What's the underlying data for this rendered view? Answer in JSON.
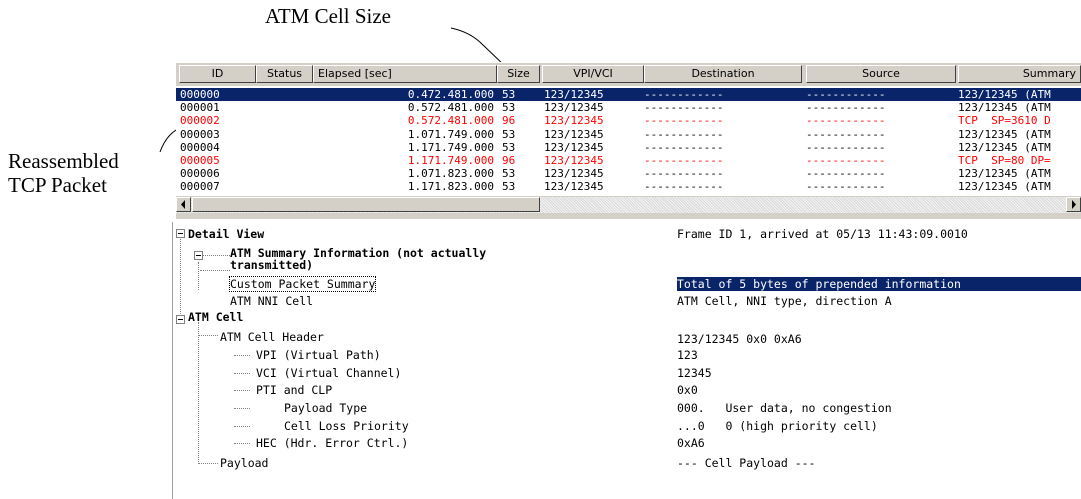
{
  "annotations": {
    "cell_size": "ATM Cell Size",
    "tcp_line1": "Reassembled",
    "tcp_line2": "TCP Packet"
  },
  "columns": [
    "ID",
    "Status",
    "Elapsed [sec]",
    "Size",
    "VPI/VCI",
    "Destination",
    "Source",
    "Summary"
  ],
  "frames": [
    {
      "id": "000000",
      "status": "",
      "elapsed": "0.472.481.000",
      "size": "53",
      "vpivci": "123/12345",
      "dest": "------------",
      "src": "------------",
      "summary": "123/12345 (ATM",
      "style": "selected"
    },
    {
      "id": "000001",
      "status": "",
      "elapsed": "0.572.481.000",
      "size": "53",
      "vpivci": "123/12345",
      "dest": "------------",
      "src": "------------",
      "summary": "123/12345 (ATM",
      "style": "normal"
    },
    {
      "id": "000002",
      "status": "",
      "elapsed": "0.572.481.000",
      "size": "96",
      "vpivci": "123/12345",
      "dest": "------------",
      "src": "------------",
      "summary": "TCP  SP=3610 D",
      "style": "red"
    },
    {
      "id": "000003",
      "status": "",
      "elapsed": "1.071.749.000",
      "size": "53",
      "vpivci": "123/12345",
      "dest": "------------",
      "src": "------------",
      "summary": "123/12345 (ATM",
      "style": "normal"
    },
    {
      "id": "000004",
      "status": "",
      "elapsed": "1.171.749.000",
      "size": "53",
      "vpivci": "123/12345",
      "dest": "------------",
      "src": "------------",
      "summary": "123/12345 (ATM",
      "style": "normal"
    },
    {
      "id": "000005",
      "status": "",
      "elapsed": "1.171.749.000",
      "size": "96",
      "vpivci": "123/12345",
      "dest": "------------",
      "src": "------------",
      "summary": "TCP  SP=80 DP=",
      "style": "red"
    },
    {
      "id": "000006",
      "status": "",
      "elapsed": "1.071.823.000",
      "size": "53",
      "vpivci": "123/12345",
      "dest": "------------",
      "src": "------------",
      "summary": "123/12345 (ATM",
      "style": "normal"
    },
    {
      "id": "000007",
      "status": "",
      "elapsed": "1.171.823.000",
      "size": "53",
      "vpivci": "123/12345",
      "dest": "------------",
      "src": "------------",
      "summary": "123/12345 (ATM",
      "style": "normal"
    }
  ],
  "detail": {
    "root_label": "Detail View",
    "root_value": "Frame ID 1, arrived at 05/13 11:43:09.0010",
    "atm_summary_label_1": "ATM Summary Information (not actually",
    "atm_summary_label_2": "transmitted)",
    "custom_summary_label": "Custom Packet Summary",
    "custom_summary_value": "Total of 5 bytes of prepended information",
    "nni_cell_label": "ATM NNI Cell",
    "nni_cell_value": "ATM Cell, NNI type, direction A",
    "atm_cell_label": "ATM Cell",
    "header_label": "ATM Cell Header",
    "header_value": "123/12345 0x0 0xA6",
    "vpi_label": "VPI (Virtual Path)",
    "vpi_value": "123",
    "vci_label": "VCI (Virtual Channel)",
    "vci_value": "12345",
    "pti_label": "PTI and CLP",
    "pti_value": "0x0",
    "payload_type_label": "Payload Type",
    "payload_type_value": "000.   User data, no congestion",
    "clp_label": "Cell Loss Priority",
    "clp_value": "...0   0 (high priority cell)",
    "hec_label": "HEC (Hdr. Error Ctrl.)",
    "hec_value": "0xA6",
    "payload_label": "Payload",
    "payload_value": "--- Cell Payload ---"
  },
  "colors": {
    "selection": "#0a246a",
    "highlight_row": "#ff0000",
    "chrome": "#d4d0c8"
  }
}
